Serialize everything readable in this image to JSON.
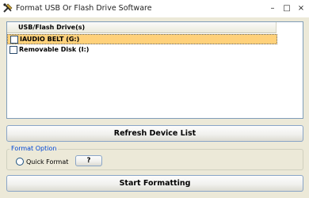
{
  "window": {
    "title": "Format USB Or Flash Drive Software",
    "minimize_glyph": "–",
    "maximize_glyph": "□",
    "close_glyph": "×",
    "app_icon": "tools-icon"
  },
  "device_list": {
    "column_header": "USB/Flash Drive(s)",
    "items": [
      {
        "label": "IAUDIO BELT (G:)",
        "checked": false,
        "selected": true
      },
      {
        "label": "Removable Disk (I:)",
        "checked": false,
        "selected": false
      }
    ]
  },
  "buttons": {
    "refresh": "Refresh Device List",
    "help": "?",
    "start": "Start Formatting"
  },
  "format_option": {
    "group_label": "Format Option",
    "quick_format_label": "Quick Format",
    "quick_format_selected": false
  },
  "colors": {
    "selection": "#ffd17a",
    "group_label": "#0046d5",
    "list_border": "#7f9db9"
  }
}
